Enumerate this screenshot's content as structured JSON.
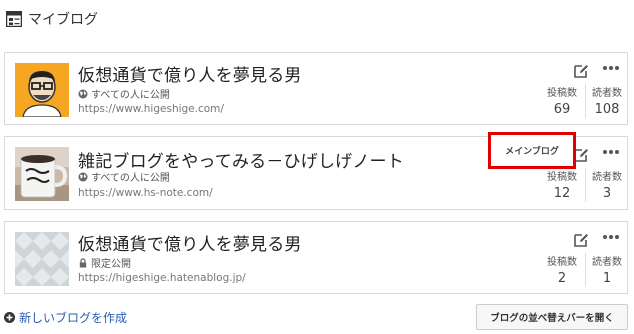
{
  "header": {
    "title": "マイブログ",
    "icon": "blog-list-icon"
  },
  "blogs": [
    {
      "title": "仮想通貨で億り人を夢見る男",
      "visibility": "すべての人に公開",
      "visibility_icon": "globe-icon",
      "url": "https://www.higeshige.com/",
      "posts_label": "投稿数",
      "posts": "69",
      "readers_label": "読者数",
      "readers": "108",
      "thumbnail": "avatar-face"
    },
    {
      "title": "雑記ブログをやってみる－ひげしげノート",
      "visibility": "すべての人に公開",
      "visibility_icon": "globe-icon",
      "url": "https://www.hs-note.com/",
      "posts_label": "投稿数",
      "posts": "12",
      "readers_label": "読者数",
      "readers": "3",
      "thumbnail": "mug-photo",
      "badge": "メインブログ"
    },
    {
      "title": "仮想通貨で億り人を夢見る男",
      "visibility": "限定公開",
      "visibility_icon": "lock-icon",
      "url": "https://higeshige.hatenablog.jp/",
      "posts_label": "投稿数",
      "posts": "2",
      "readers_label": "読者数",
      "readers": "1",
      "thumbnail": "placeholder-pattern"
    }
  ],
  "footer": {
    "create_label": "新しいブログを作成",
    "sort_label": "ブログの並べ替えバーを開く"
  },
  "colors": {
    "accent_link": "#2a5db0",
    "badge_border": "#e00000"
  }
}
